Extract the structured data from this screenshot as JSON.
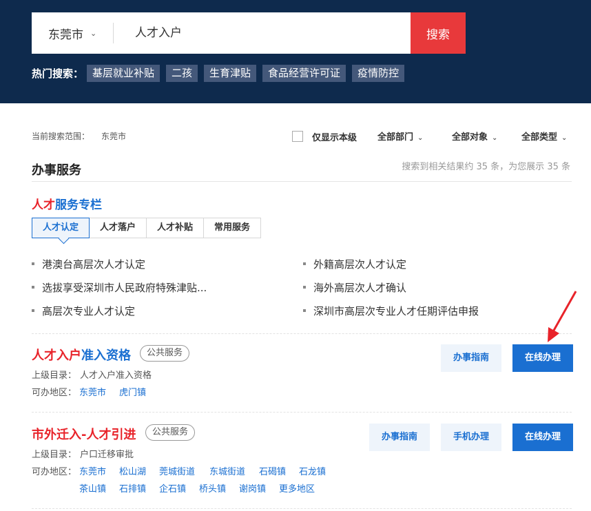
{
  "search": {
    "city": "东莞市",
    "query": "人才入户",
    "button": "搜索"
  },
  "hot": {
    "label": "热门搜索：",
    "tags": [
      "基层就业补贴",
      "二孩",
      "生育津贴",
      "食品经营许可证",
      "疫情防控"
    ]
  },
  "filters": {
    "scope_label": "当前搜索范围：",
    "scope_value": "东莞市",
    "local_only": "仅显示本级",
    "department": "全部部门",
    "audience": "全部对象",
    "type": "全部类型"
  },
  "section": {
    "title": "办事服务",
    "count": "搜索到相关结果约 35 条，为您展示 35 条"
  },
  "column": {
    "title_red": "人才",
    "title_blue": "服务专栏",
    "tabs": [
      "人才认定",
      "人才落户",
      "人才补贴",
      "常用服务"
    ],
    "active_tab": "人才认定",
    "items": [
      "港澳台高层次人才认定",
      "外籍高层次人才认定",
      "选拔享受深圳市人民政府特殊津贴...",
      "海外高层次人才确认",
      "高层次专业人才认定",
      "深圳市高层次专业人才任期评估申报"
    ]
  },
  "services": [
    {
      "title_red": "人才入户",
      "title_blue": "准入资格",
      "badge": "公共服务",
      "parent_label": "上级目录：",
      "parent_value": "人才入户准入资格",
      "area_label": "可办地区：",
      "areas": [
        "东莞市",
        "虎门镇"
      ],
      "guide": "办事指南",
      "online": "在线办理"
    },
    {
      "title_red": "市外迁入-人才引进",
      "title_blue": "",
      "badge": "公共服务",
      "parent_label": "上级目录：",
      "parent_value": "户口迁移审批",
      "area_label": "可办地区：",
      "areas": [
        "东莞市",
        "松山湖",
        "莞城街道",
        "东城街道",
        "石碣镇",
        "石龙镇",
        "茶山镇",
        "石排镇",
        "企石镇",
        "桥头镇",
        "谢岗镇",
        "更多地区"
      ],
      "guide": "办事指南",
      "mobile": "手机办理",
      "online": "在线办理"
    }
  ],
  "colors": {
    "header_bg": "#0e2a4d",
    "accent_red": "#e8393b",
    "link_blue": "#1a6fd1"
  }
}
